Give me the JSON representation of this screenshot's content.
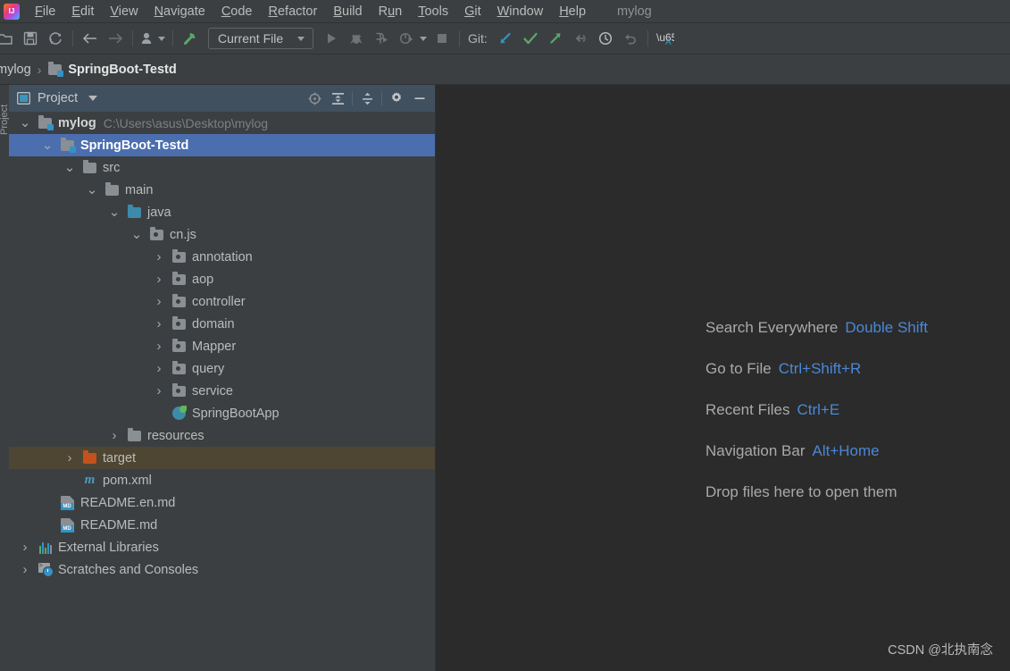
{
  "window": {
    "project_title": "mylog",
    "logo": "intellij-idea-logo"
  },
  "menubar": {
    "items": [
      {
        "label": "File",
        "mnemonic": "F"
      },
      {
        "label": "Edit",
        "mnemonic": "E"
      },
      {
        "label": "View",
        "mnemonic": "V"
      },
      {
        "label": "Navigate",
        "mnemonic": "N"
      },
      {
        "label": "Code",
        "mnemonic": "C"
      },
      {
        "label": "Refactor",
        "mnemonic": "R"
      },
      {
        "label": "Build",
        "mnemonic": "B"
      },
      {
        "label": "Run",
        "mnemonic": "u"
      },
      {
        "label": "Tools",
        "mnemonic": "T"
      },
      {
        "label": "Git",
        "mnemonic": "G"
      },
      {
        "label": "Window",
        "mnemonic": "W"
      },
      {
        "label": "Help",
        "mnemonic": "H"
      }
    ]
  },
  "toolbar": {
    "open_label": "open-project",
    "save_label": "save-all",
    "sync_label": "sync-reload",
    "back_label": "navigate-back",
    "forward_label": "navigate-forward",
    "profile_label": "user-profile",
    "build_label": "build-project",
    "run_config": "Current File",
    "run_label": "run",
    "debug_label": "debug",
    "run_coverage_label": "run-with-coverage",
    "profiler_label": "profiler",
    "stop_label": "stop",
    "git_label": "Git:",
    "git_update_label": "update-project",
    "git_commit_label": "commit",
    "git_push_label": "push",
    "git_branch_label": "checkout-branch",
    "git_history_label": "show-history",
    "git_rollback_label": "rollback",
    "translate_label": "translate"
  },
  "breadcrumb": {
    "root": "mylog",
    "separator": "›",
    "current": "SpringBoot-Testd"
  },
  "left_strip": {
    "label": "Project"
  },
  "panel": {
    "title": "Project",
    "locate_label": "select-opened-file",
    "expand_label": "expand-all",
    "collapse_label": "collapse-all",
    "settings_label": "panel-settings",
    "hide_label": "hide-panel"
  },
  "tree": {
    "rows": [
      {
        "label": "mylog",
        "detail": "C:\\Users\\asus\\Desktop\\mylog",
        "indent": 0,
        "arrow": "down",
        "icon": "module-folder",
        "style": "bold",
        "state": "normal"
      },
      {
        "label": "SpringBoot-Testd",
        "detail": "",
        "indent": 1,
        "arrow": "down",
        "icon": "module-folder",
        "style": "bold-white",
        "state": "selected"
      },
      {
        "label": "src",
        "detail": "",
        "indent": 2,
        "arrow": "down",
        "icon": "folder",
        "style": "normal",
        "state": "normal"
      },
      {
        "label": "main",
        "detail": "",
        "indent": 3,
        "arrow": "down",
        "icon": "folder",
        "style": "normal",
        "state": "normal"
      },
      {
        "label": "java",
        "detail": "",
        "indent": 4,
        "arrow": "down",
        "icon": "source-folder",
        "style": "normal",
        "state": "normal"
      },
      {
        "label": "cn.js",
        "detail": "",
        "indent": 5,
        "arrow": "down",
        "icon": "package-folder",
        "style": "normal",
        "state": "normal"
      },
      {
        "label": "annotation",
        "detail": "",
        "indent": 6,
        "arrow": "right",
        "icon": "package-folder",
        "style": "normal",
        "state": "normal"
      },
      {
        "label": "aop",
        "detail": "",
        "indent": 6,
        "arrow": "right",
        "icon": "package-folder",
        "style": "normal",
        "state": "normal"
      },
      {
        "label": "controller",
        "detail": "",
        "indent": 6,
        "arrow": "right",
        "icon": "package-folder",
        "style": "normal",
        "state": "normal"
      },
      {
        "label": "domain",
        "detail": "",
        "indent": 6,
        "arrow": "right",
        "icon": "package-folder",
        "style": "normal",
        "state": "normal"
      },
      {
        "label": "Mapper",
        "detail": "",
        "indent": 6,
        "arrow": "right",
        "icon": "package-folder",
        "style": "normal",
        "state": "normal"
      },
      {
        "label": "query",
        "detail": "",
        "indent": 6,
        "arrow": "right",
        "icon": "package-folder",
        "style": "normal",
        "state": "normal"
      },
      {
        "label": "service",
        "detail": "",
        "indent": 6,
        "arrow": "right",
        "icon": "package-folder",
        "style": "normal",
        "state": "normal"
      },
      {
        "label": "SpringBootApp",
        "detail": "",
        "indent": 6,
        "arrow": "none",
        "icon": "spring-boot-class",
        "style": "normal",
        "state": "normal"
      },
      {
        "label": "resources",
        "detail": "",
        "indent": 4,
        "arrow": "right",
        "icon": "folder",
        "style": "normal",
        "state": "normal"
      },
      {
        "label": "target",
        "detail": "",
        "indent": 2,
        "arrow": "right",
        "icon": "excluded-folder",
        "style": "normal",
        "state": "marked"
      },
      {
        "label": "pom.xml",
        "detail": "",
        "indent": 2,
        "arrow": "none",
        "icon": "maven-file",
        "style": "normal",
        "state": "normal"
      },
      {
        "label": "README.en.md",
        "detail": "",
        "indent": 1,
        "arrow": "none",
        "icon": "markdown-file",
        "style": "normal",
        "state": "normal"
      },
      {
        "label": "README.md",
        "detail": "",
        "indent": 1,
        "arrow": "none",
        "icon": "markdown-file",
        "style": "normal",
        "state": "normal"
      },
      {
        "label": "External Libraries",
        "detail": "",
        "indent": 0,
        "arrow": "right",
        "icon": "external-libraries",
        "style": "normal",
        "state": "normal"
      },
      {
        "label": "Scratches and Consoles",
        "detail": "",
        "indent": 0,
        "arrow": "right",
        "icon": "scratches",
        "style": "normal",
        "state": "normal"
      }
    ]
  },
  "editor": {
    "hints": [
      {
        "label": "Search Everywhere",
        "key": "Double Shift"
      },
      {
        "label": "Go to File",
        "key": "Ctrl+Shift+R"
      },
      {
        "label": "Recent Files",
        "key": "Ctrl+E"
      },
      {
        "label": "Navigation Bar",
        "key": "Alt+Home"
      },
      {
        "label": "Drop files here to open them",
        "key": ""
      }
    ],
    "watermark": "CSDN @北执南念"
  },
  "colors": {
    "selection": "#4b6eaf",
    "marked_row": "#4e4632",
    "hint_key": "#4a88d6",
    "panel_bg": "#3c3f41",
    "editor_bg": "#2b2b2b",
    "header_bg": "#41505f",
    "git_update": "#3592c4",
    "git_commit": "#59a869",
    "git_push": "#59a869",
    "build_hammer": "#59a869"
  }
}
